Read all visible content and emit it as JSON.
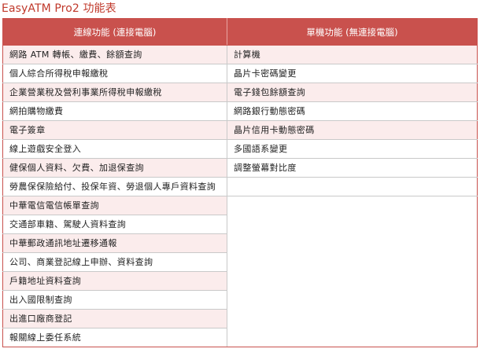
{
  "title": "EasyATM Pro2 功能表",
  "table": {
    "headers": [
      "連線功能 (連接電腦)",
      "單機功能 (無連接電腦)"
    ],
    "online_features": [
      "網路 ATM 轉帳、繳費、餘額查詢",
      "個人綜合所得稅申報繳稅",
      "企業營業稅及營利事業所得稅申報繳稅",
      "網拍購物繳費",
      "電子簽章",
      "線上遊戲安全登入",
      "健保個人資料、欠費、加退保查詢",
      "勞農保保險給付、投保年資、勞退個人專戶資料查詢",
      "中華電信電信帳單查詢",
      "交通部車籍、駕駛人資料查詢",
      "中華郵政通訊地址遷移通報",
      "公司、商業登記線上申辦、資料查詢",
      "戶籍地址資料查詢",
      "出入國限制查詢",
      "出進口廠商登記",
      "報關線上委任系統"
    ],
    "offline_features": [
      "計算機",
      "晶片卡密碼變更",
      "電子錢包餘額查詢",
      "網路銀行動態密碼",
      "晶片信用卡動態密碼",
      "多國語系變更",
      "調整螢幕對比度"
    ]
  }
}
